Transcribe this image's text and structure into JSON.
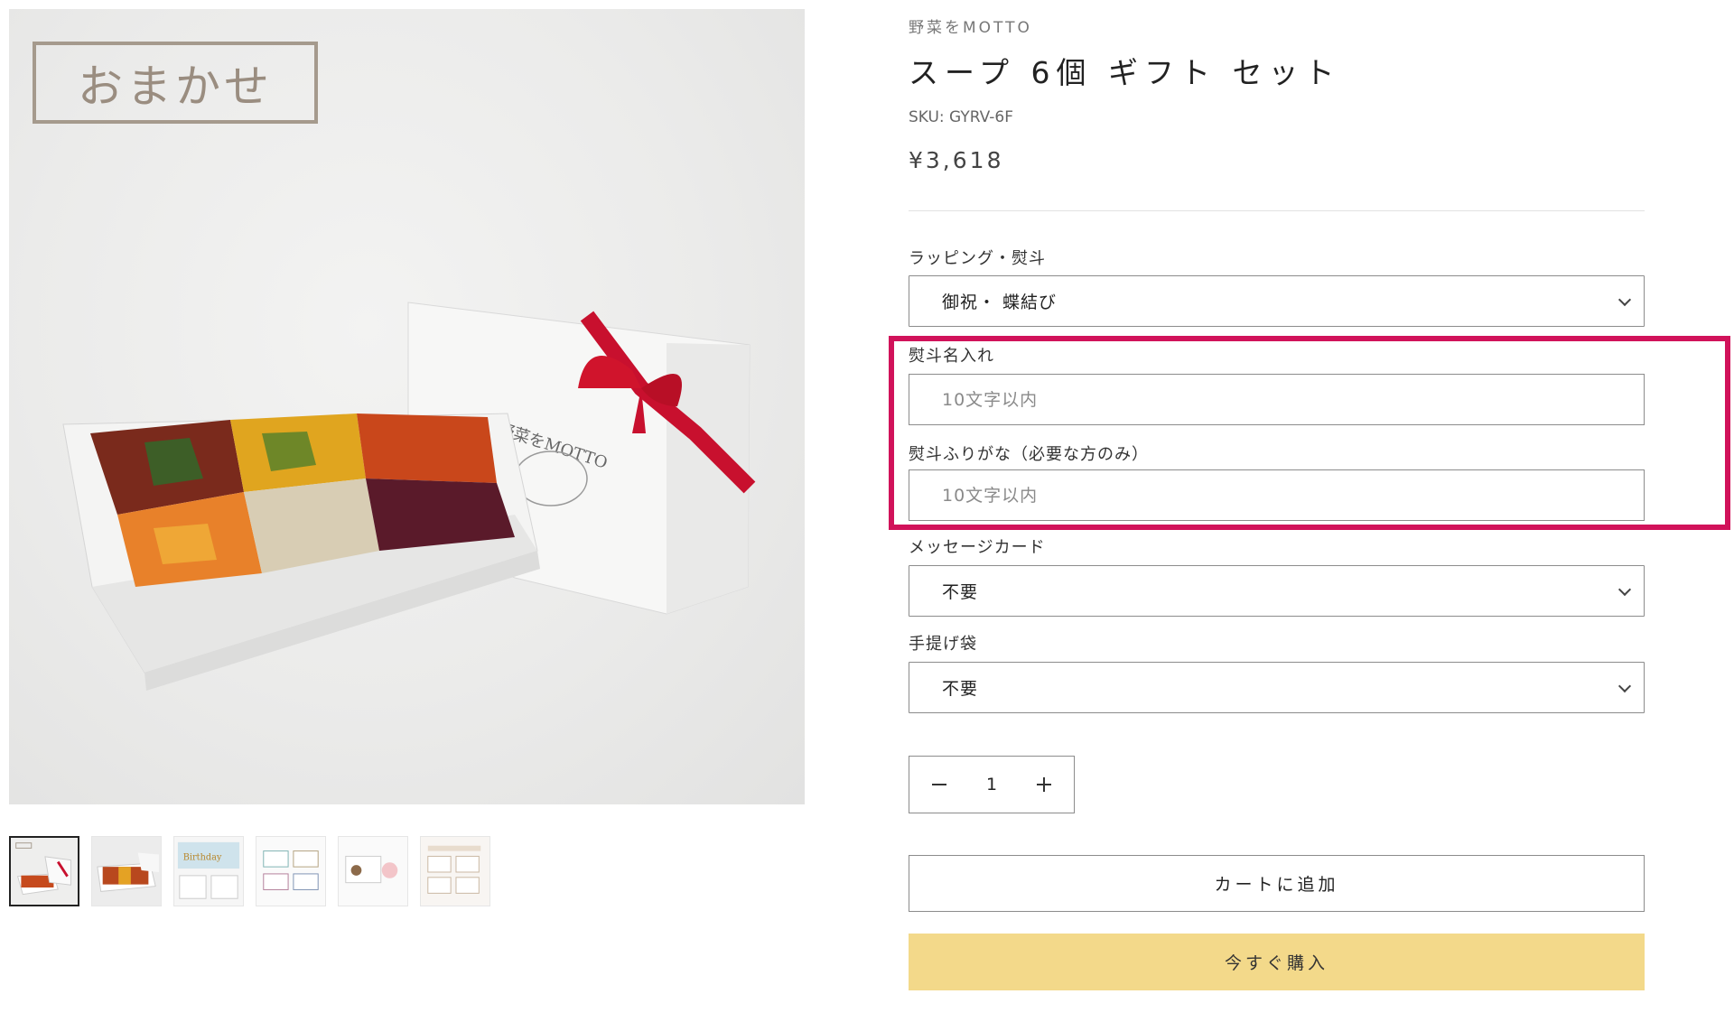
{
  "media": {
    "badge_text": "おまかせ",
    "main_image_alt": "product-gift-box-photo",
    "thumbnails": [
      {
        "name": "thumb-gift-box",
        "active": true
      },
      {
        "name": "thumb-open-box",
        "active": false
      },
      {
        "name": "thumb-birthday-card",
        "active": false
      },
      {
        "name": "thumb-message-cards",
        "active": false
      },
      {
        "name": "thumb-original-message-card",
        "active": false
      },
      {
        "name": "thumb-noshi-cards",
        "active": false
      }
    ]
  },
  "product": {
    "vendor": "野菜をMOTTO",
    "title": "スープ 6個 ギフト セット",
    "sku": "SKU: GYRV-6F",
    "price": "¥3,618"
  },
  "options": {
    "wrapping": {
      "label": "ラッピング・熨斗",
      "value": "御祝・ 蝶結び"
    },
    "noshi_name": {
      "label": "熨斗名入れ",
      "placeholder": "10文字以内",
      "value": ""
    },
    "noshi_furigana": {
      "label": "熨斗ふりがな（必要な方のみ）",
      "placeholder": "10文字以内",
      "value": ""
    },
    "message_card": {
      "label": "メッセージカード",
      "value": "不要"
    },
    "handbag": {
      "label": "手提げ袋",
      "value": "不要"
    }
  },
  "quantity": {
    "value": "1"
  },
  "actions": {
    "add_to_cart": "カートに追加",
    "buy_now": "今すぐ購入"
  },
  "colors": {
    "highlight": "#d1125a",
    "buy_button": "#f3d98a",
    "badge_border": "#a59a8d"
  }
}
